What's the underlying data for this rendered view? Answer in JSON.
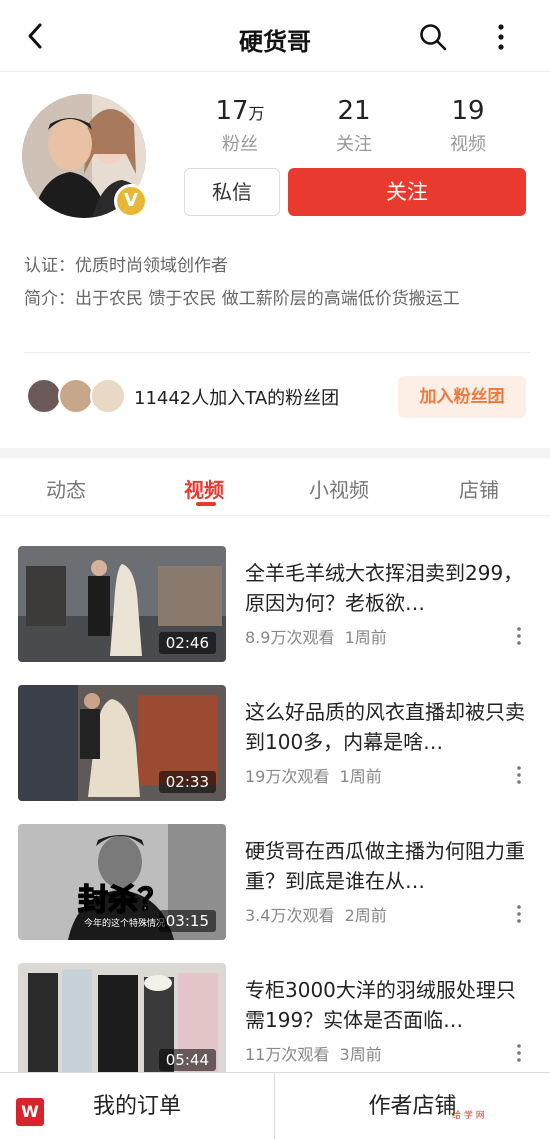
{
  "header": {
    "title": "硬货哥"
  },
  "stats": [
    {
      "value": "17",
      "unit": "万",
      "label": "粉丝"
    },
    {
      "value": "21",
      "unit": "",
      "label": "关注"
    },
    {
      "value": "19",
      "unit": "",
      "label": "视频"
    }
  ],
  "badge": {
    "letter": "V",
    "color": "#e8b735"
  },
  "buttons": {
    "message": "私信",
    "follow": "关注"
  },
  "profile": {
    "cert_label": "认证：",
    "cert_text": "优质时尚领域创作者",
    "intro_label": "简介：",
    "intro_text": "出于农民 馈于农民 做工薪阶层的高端低价货搬运工"
  },
  "fan_club": {
    "text": "11442人加入TA的粉丝团",
    "join_button": "加入粉丝团"
  },
  "tabs": [
    {
      "label": "动态",
      "active": false
    },
    {
      "label": "视频",
      "active": true
    },
    {
      "label": "小视频",
      "active": false
    },
    {
      "label": "店铺",
      "active": false
    }
  ],
  "videos": [
    {
      "title": "全羊毛羊绒大衣挥泪卖到299，原因为何？老板欲…",
      "duration": "02:46",
      "views": "8.9万次观看",
      "time": "1周前"
    },
    {
      "title": "这么好品质的风衣直播却被只卖到100多，内幕是啥…",
      "duration": "02:33",
      "views": "19万次观看",
      "time": "1周前"
    },
    {
      "title": "硬货哥在西瓜做主播为何阻力重重？到底是谁在从…",
      "duration": "03:15",
      "views": "3.4万次观看",
      "time": "2周前",
      "overlay_text": "封杀？",
      "overlay_sub": "今年的这个特殊情况"
    },
    {
      "title": "专柜3000大洋的羽绒服处理只需199？实体是否面临…",
      "duration": "05:44",
      "views": "11万次观看",
      "time": "3周前"
    }
  ],
  "bottom_bar": {
    "orders": "我的订单",
    "store": "作者店铺"
  },
  "colors": {
    "accent": "#e83a2f",
    "join_bg": "#fdeee6",
    "join_text": "#f07a3c"
  }
}
